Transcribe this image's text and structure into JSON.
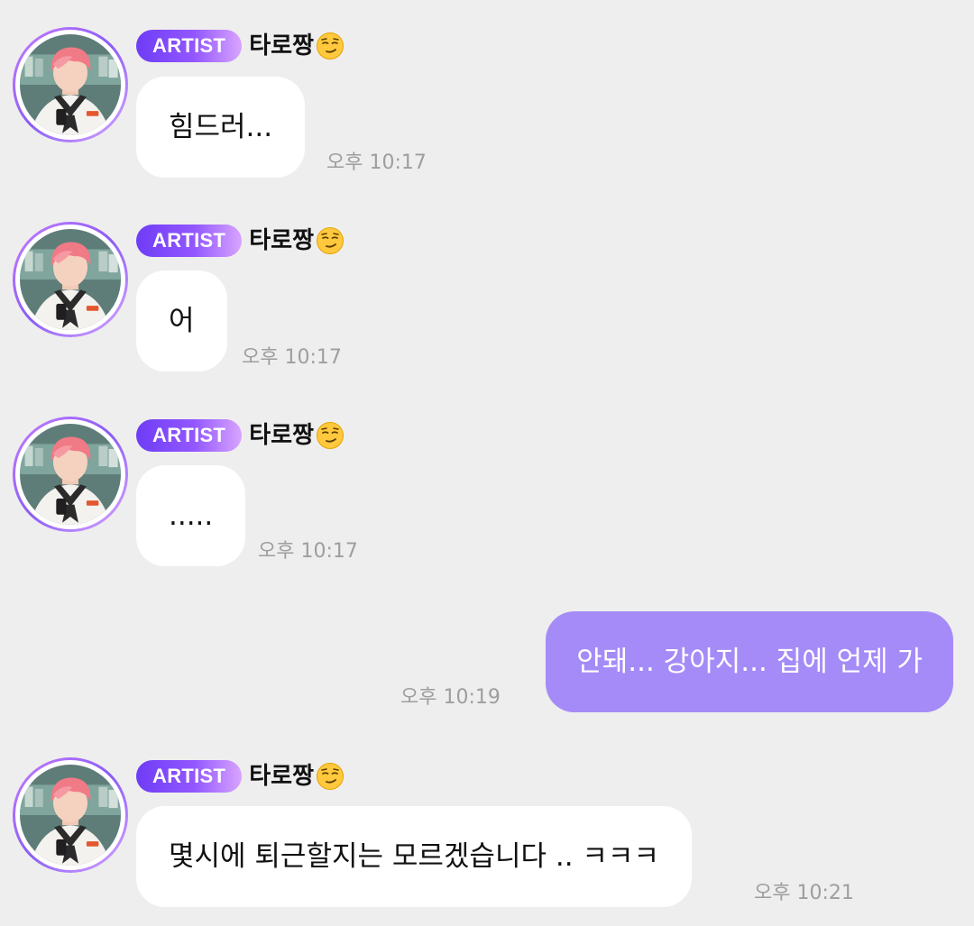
{
  "messages": [
    {
      "direction": "incoming",
      "badge": "ARTIST",
      "sender": "타로짱",
      "sender_emoji": "smirking-face-emoji",
      "text": "힘드러...",
      "time": "오후 10:17"
    },
    {
      "direction": "incoming",
      "badge": "ARTIST",
      "sender": "타로짱",
      "sender_emoji": "smirking-face-emoji",
      "text": "어",
      "time": "오후 10:17"
    },
    {
      "direction": "incoming",
      "badge": "ARTIST",
      "sender": "타로짱",
      "sender_emoji": "smirking-face-emoji",
      "text": ".....",
      "time": "오후 10:17"
    },
    {
      "direction": "outgoing",
      "text": "안돼... 강아지... 집에 언제 가",
      "time": "오후 10:19"
    },
    {
      "direction": "incoming",
      "badge": "ARTIST",
      "sender": "타로짱",
      "sender_emoji": "smirking-face-emoji",
      "text": "몇시에 퇴근할지는 모르겠습니다 .. ㅋㅋㅋ",
      "time": "오후 10:21"
    }
  ],
  "colors": {
    "background": "#eeeeee",
    "incoming_bubble": "#ffffff",
    "outgoing_bubble": "#a58bf7",
    "badge_start": "#6f3cf6",
    "badge_end": "#d9a4ff",
    "timestamp": "#9e9e9e"
  }
}
